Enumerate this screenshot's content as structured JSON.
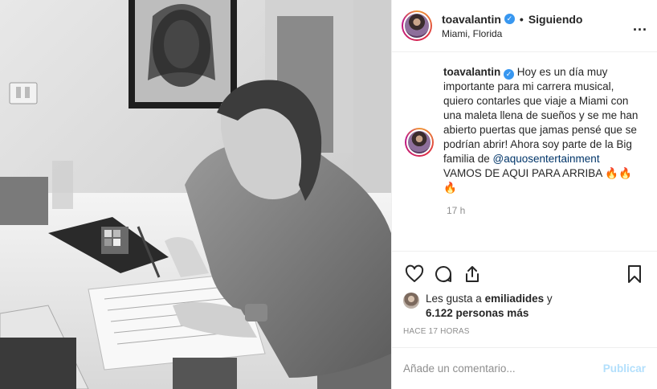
{
  "header": {
    "username": "toavalantin",
    "separator": "•",
    "follow_status": "Siguiendo",
    "location": "Miami, Florida",
    "more_label": "..."
  },
  "caption": {
    "username": "toavalantin",
    "text_part1": "Hoy es un día muy importante para mi carrera musical, quiero contarles que viaje a Miami con una maleta llena de sueños y se me han abierto puertas que jamas pensé que se podrían abrir! Ahora soy parte de la Big familia de ",
    "mention": "@aquosentertainment",
    "text_part2": "VAMOS DE AQUI PARA ARRIBA",
    "emoji1": "🔥🔥",
    "emoji2": "🔥",
    "time": "17 h"
  },
  "likes": {
    "prefix": "Les gusta a ",
    "user": "emiliadides",
    "mid": " y ",
    "count": "6.122 personas más"
  },
  "posted_ago": "HACE 17 HORAS",
  "comment_box": {
    "placeholder": "Añade un comentario...",
    "post_label": "Publicar"
  },
  "icons": {
    "verified": "verified-badge-icon",
    "like": "heart-icon",
    "comment": "comment-icon",
    "share": "share-icon",
    "save": "bookmark-icon",
    "more": "more-options-icon"
  },
  "colors": {
    "verified_blue": "#3897f0",
    "mention_blue": "#003569",
    "post_disabled": "#b2dffc",
    "muted": "#8e8e8e"
  }
}
